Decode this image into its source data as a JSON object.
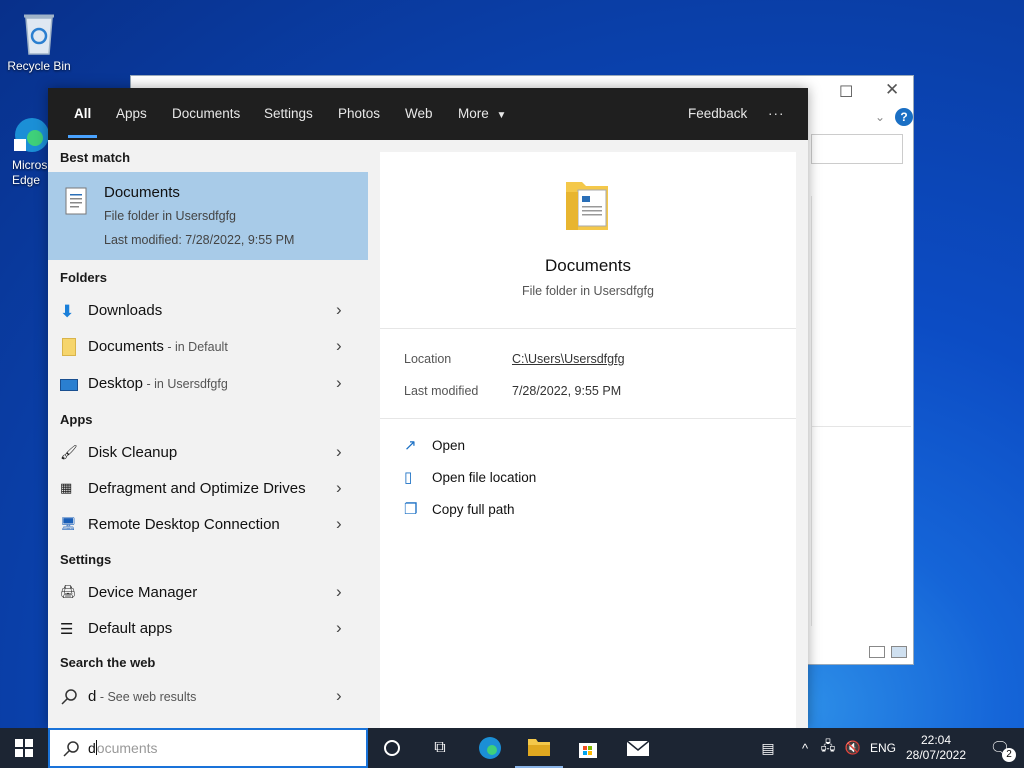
{
  "desktop": {
    "recycle_bin": "Recycle Bin",
    "edge_label": "Micros\nEdge"
  },
  "tabs": [
    "All",
    "Apps",
    "Documents",
    "Settings",
    "Photos",
    "Web",
    "More"
  ],
  "feedback": "Feedback",
  "more_options": "···",
  "best_match": {
    "header": "Best match",
    "title": "Documents",
    "type": "File folder in Usersdfgfg",
    "modified": "Last modified: 7/28/2022, 9:55 PM"
  },
  "folders": {
    "header": "Folders",
    "items": [
      {
        "label": "Downloads",
        "sub": ""
      },
      {
        "label": "Documents",
        "sub": " - in Default"
      },
      {
        "label": "Desktop",
        "sub": " - in Usersdfgfg"
      }
    ]
  },
  "apps": {
    "header": "Apps",
    "items": [
      {
        "label": "Disk Cleanup"
      },
      {
        "label": "Defragment and Optimize Drives"
      },
      {
        "label": "Remote Desktop Connection"
      }
    ]
  },
  "settings": {
    "header": "Settings",
    "items": [
      {
        "label": "Device Manager"
      },
      {
        "label": "Default apps"
      }
    ]
  },
  "web": {
    "header": "Search the web",
    "query": "d",
    "sub": " - See web results"
  },
  "preview": {
    "title": "Documents",
    "type": "File folder in Usersdfgfg",
    "location_label": "Location",
    "location_value": "C:\\Users\\Usersdfgfg",
    "modified_label": "Last modified",
    "modified_value": "7/28/2022, 9:55 PM",
    "actions": [
      "Open",
      "Open file location",
      "Copy full path"
    ]
  },
  "search": {
    "typed": "d",
    "suggestion": "ocuments"
  },
  "tray": {
    "language": "ENG",
    "time": "22:04",
    "date": "28/07/2022",
    "notifications": "2"
  },
  "colors": {
    "accent": "#4aa3ff",
    "best_match_bg": "#a8cbe8",
    "taskbar": "#1c2533"
  }
}
